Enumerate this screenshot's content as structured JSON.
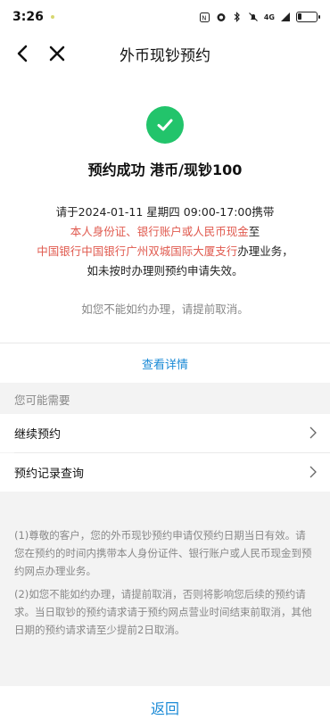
{
  "status_bar": {
    "time": "3:26",
    "network": "4G"
  },
  "nav": {
    "title": "外币现钞预约"
  },
  "result": {
    "title": "预约成功 港币/现钞100",
    "line1": "请于2024-01-11 星期四 09:00-17:00携带",
    "line2_red": "本人身份证、银行账户或人民币现金",
    "line2_suffix": "至",
    "line3_red": "中国银行中国银行广州双城国际大厦支行",
    "line3_suffix": "办理业务，",
    "line4": "如未按时办理则预约申请失效。",
    "cancel_hint": "如您不能如约办理，请提前取消。"
  },
  "view_details_label": "查看详情",
  "section_label": "您可能需要",
  "menu": [
    {
      "label": "继续预约"
    },
    {
      "label": "预约记录查询"
    }
  ],
  "notes": [
    "(1)尊敬的客户，您的外币现钞预约申请仅预约日期当日有效。请您在预约的时间内携带本人身份证件、银行账户或人民币现金到预约网点办理业务。",
    "(2)如您不能如约办理，请提前取消，否则将影响您后续的预约请求。当日取钞的预约请求请于预约网点营业时间结束前取消，其他日期的预约请求请至少提前2日取消。"
  ],
  "bottom_button_label": "返回",
  "colors": {
    "accent_blue": "#1a8ad6",
    "success_green": "#22c46b",
    "highlight_red": "#e05a4f"
  }
}
